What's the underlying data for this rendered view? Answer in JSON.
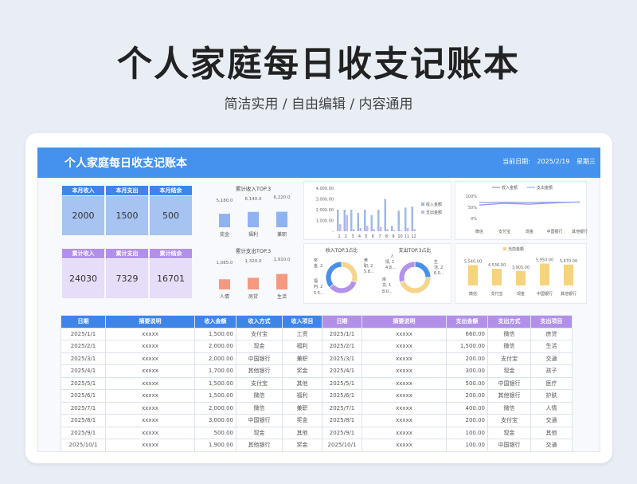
{
  "hero": {
    "title": "个人家庭每日收支记账本",
    "subtitle": "简洁实用 / 自由编辑 / 内容通用"
  },
  "banner": {
    "title": "个人家庭每日收支记账本",
    "date_label": "当前日期:",
    "date": "2025/2/19",
    "weekday": "星期三"
  },
  "kpi_month": {
    "labels": [
      "本月收入",
      "本月支出",
      "本月结余"
    ],
    "values": [
      "2000",
      "1500",
      "500"
    ]
  },
  "kpi_total": {
    "labels": [
      "累计收入",
      "累计支出",
      "累计结余"
    ],
    "values": [
      "24030",
      "7329",
      "16701"
    ]
  },
  "colors": {
    "blue": "#4492ee",
    "purple": "#b290ea",
    "income_bar": "#8fb3f0",
    "expense_bar": "#f4997f",
    "yellow": "#f6d37e",
    "donut_blue": "#4a90e8",
    "donut_purple": "#b392ea",
    "donut_yellow": "#f5d58b"
  },
  "chart_data": [
    {
      "type": "bar",
      "title": "累计收入TOP.3",
      "categories": [
        "奖金",
        "福利",
        "兼职"
      ],
      "values": [
        5180.0,
        6140.0,
        6220.0
      ],
      "labels": [
        "5,180.0",
        "6,140.0",
        "6,220.0"
      ]
    },
    {
      "type": "bar",
      "title": "累计支出TOP.3",
      "categories": [
        "人情",
        "房贷",
        "生活"
      ],
      "values": [
        1085.0,
        1320.0,
        1910.0
      ],
      "labels": [
        "1,085.0",
        "1,320.0",
        "1,910.0"
      ]
    },
    {
      "type": "bar",
      "series": [
        {
          "name": "收入金额",
          "values": [
            2000,
            2000,
            2000,
            1700,
            2000,
            1500,
            2000,
            3000,
            500,
            1900,
            2200,
            2300
          ]
        },
        {
          "name": "支出金额",
          "values": [
            660,
            1500,
            200,
            300,
            500,
            200,
            400,
            200,
            100,
            100,
            300,
            200
          ]
        }
      ],
      "categories": [
        "1",
        "2",
        "3",
        "4",
        "5",
        "6",
        "7",
        "8",
        "9",
        "10",
        "11",
        "12"
      ],
      "yticks": [
        "4,000.00",
        "3,000.00",
        "2,000.00",
        "1,000.00",
        "-"
      ],
      "ylim": [
        0,
        4000
      ]
    },
    {
      "type": "line",
      "series": [
        {
          "name": "收入金额",
          "values": [
            60,
            68,
            64,
            70,
            74
          ]
        },
        {
          "name": "支出金额",
          "values": [
            72,
            73,
            72,
            73,
            73
          ]
        }
      ],
      "categories": [
        "微信",
        "支付宝",
        "现金",
        "中国银行",
        "其他银行"
      ],
      "yticks": [
        "100%",
        "50%",
        "0%"
      ],
      "ylim": [
        0,
        100
      ]
    },
    {
      "type": "pie",
      "title": "收入TOP.3占比",
      "slices": [
        {
          "label": "奖金, 2",
          "value": 30
        },
        {
          "label": "兼职, 2 5.8...",
          "value": 34
        },
        {
          "label": "福利, 2 5.5...",
          "value": 36
        }
      ],
      "labels": [
        "奖",
        "金, 2",
        "黄",
        "职, 2",
        "5.8...",
        "福",
        "利, 2",
        "5.5..."
      ]
    },
    {
      "type": "pie",
      "title": "支出TOP.3占比",
      "slices": [
        {
          "label": "人情, 1 4.8...",
          "value": 25
        },
        {
          "label": "生活, 2 6.0...",
          "value": 45
        },
        {
          "label": "房贷, 1 8.0...",
          "value": 30
        }
      ],
      "labels": [
        "人",
        "情, 1",
        "4.8...",
        "生",
        "活, 2",
        "6.0...",
        "房",
        "贷, 1",
        "8.0..."
      ]
    },
    {
      "type": "bar",
      "series": [
        {
          "name": "当前金额",
          "values": [
            5540.0,
            4536.0,
            3905.0,
            5950.0,
            5670.0
          ]
        }
      ],
      "categories": [
        "微信",
        "支付宝",
        "现金",
        "中国银行",
        "其他银行"
      ],
      "labels": [
        "5,540.00",
        "4,536.00",
        "3,905.00",
        "5,950.00",
        "5,670.00"
      ]
    }
  ],
  "income_table": {
    "headers": [
      "日期",
      "摘要说明",
      "收入金额",
      "收入方式",
      "收入项目"
    ],
    "rows": [
      [
        "2025/1/1",
        "xxxxx",
        "1,500.00",
        "支付宝",
        "工资"
      ],
      [
        "2025/2/1",
        "xxxxx",
        "2,000.00",
        "现金",
        "福利"
      ],
      [
        "2025/3/1",
        "xxxxx",
        "2,000.00",
        "中国银行",
        "兼职"
      ],
      [
        "2025/4/1",
        "xxxxx",
        "1,700.00",
        "其他银行",
        "奖金"
      ],
      [
        "2025/5/1",
        "xxxxx",
        "1,500.00",
        "支付宝",
        "其他"
      ],
      [
        "2025/6/1",
        "xxxxx",
        "1,500.00",
        "微信",
        "福利"
      ],
      [
        "2025/7/1",
        "xxxxx",
        "2,000.00",
        "微信",
        "兼职"
      ],
      [
        "2025/8/1",
        "xxxxx",
        "3,000.00",
        "中国银行",
        "奖金"
      ],
      [
        "2025/9/1",
        "xxxxx",
        "500.00",
        "现金",
        "其他"
      ],
      [
        "2025/10/1",
        "xxxxx",
        "1,900.00",
        "其他银行",
        "奖金"
      ]
    ]
  },
  "expense_table": {
    "headers": [
      "日期",
      "摘要说明",
      "支出金额",
      "支出方式",
      "支出项目"
    ],
    "rows": [
      [
        "2025/1/1",
        "xxxxx",
        "660.00",
        "微信",
        "房贷"
      ],
      [
        "2025/2/1",
        "xxxxx",
        "1,500.00",
        "微信",
        "生活"
      ],
      [
        "2025/3/1",
        "xxxxx",
        "200.00",
        "支付宝",
        "交通"
      ],
      [
        "2025/4/1",
        "xxxxx",
        "300.00",
        "现金",
        "孩子"
      ],
      [
        "2025/5/1",
        "xxxxx",
        "500.00",
        "中国银行",
        "医疗"
      ],
      [
        "2025/6/1",
        "xxxxx",
        "200.00",
        "其他银行",
        "护肤"
      ],
      [
        "2025/7/1",
        "xxxxx",
        "400.00",
        "微信",
        "人情"
      ],
      [
        "2025/8/1",
        "xxxxx",
        "200.00",
        "支付宝",
        "交通"
      ],
      [
        "2025/9/1",
        "xxxxx",
        "100.00",
        "现金",
        "其他"
      ],
      [
        "2025/10/1",
        "xxxxx",
        "100.00",
        "中国银行",
        "交通"
      ]
    ]
  }
}
